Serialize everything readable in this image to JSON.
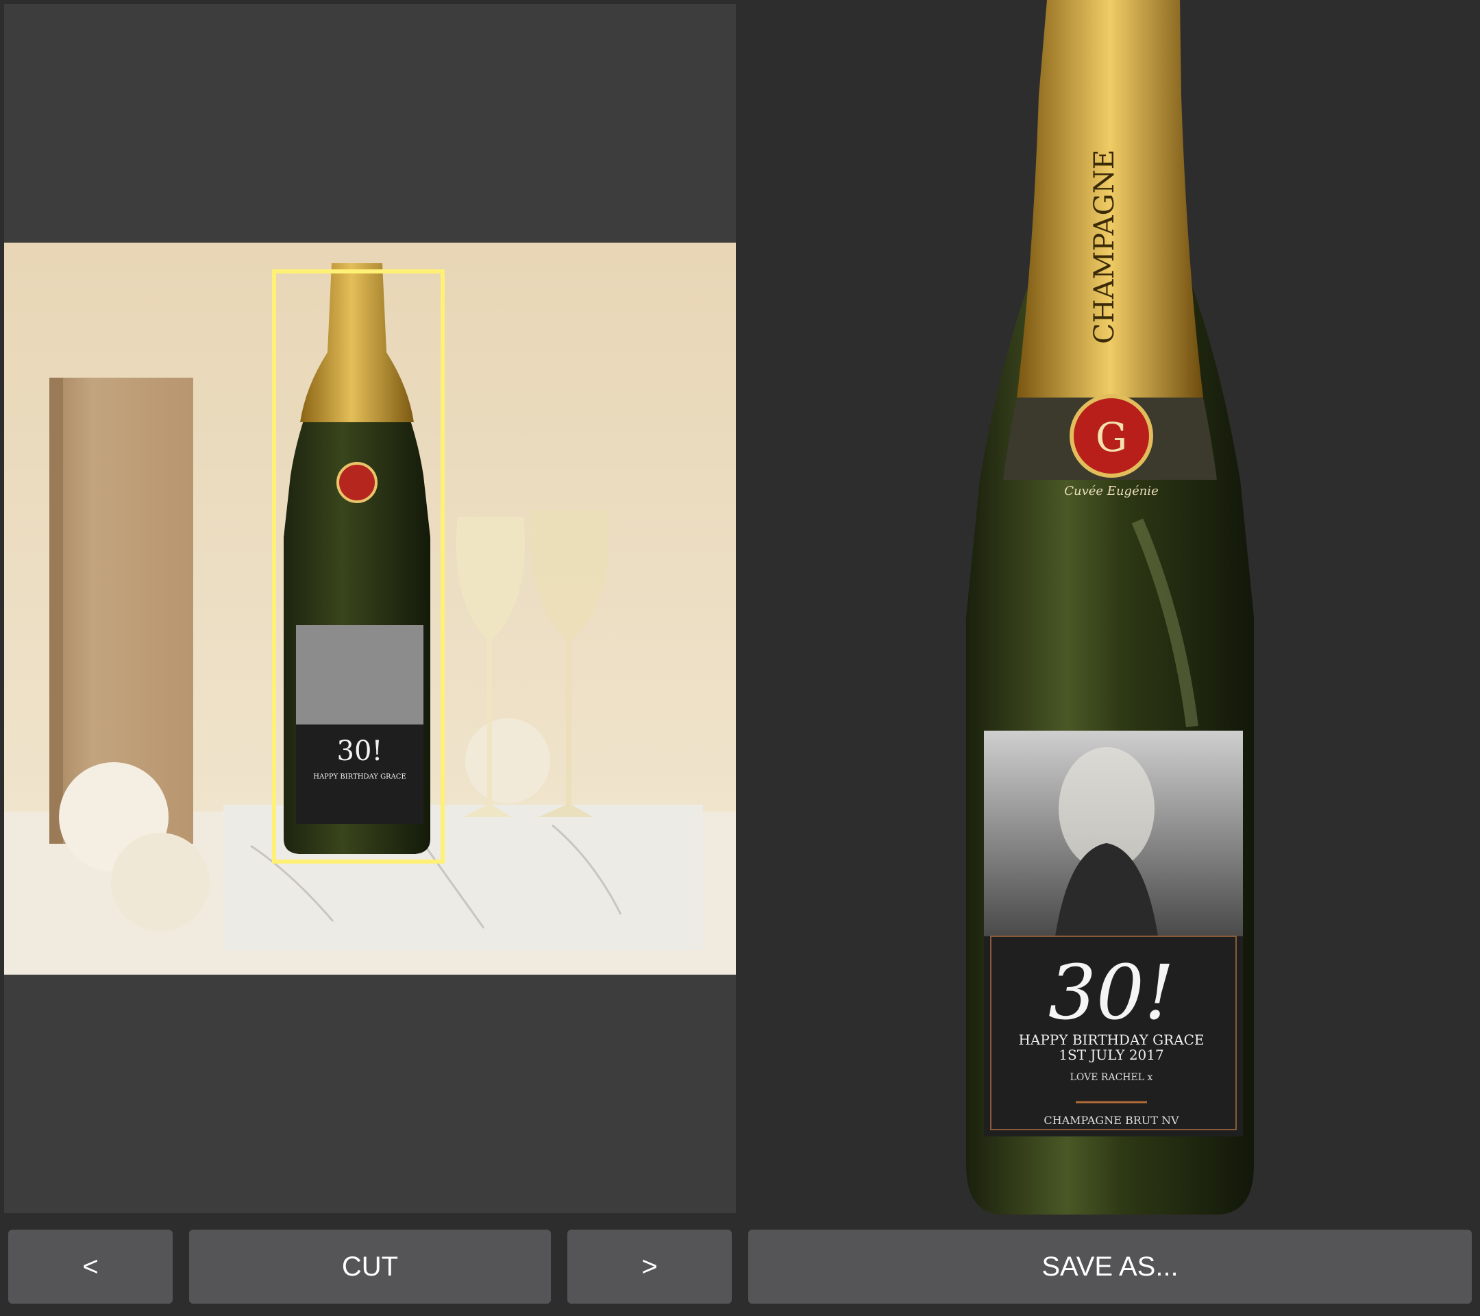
{
  "editor": {
    "source_panel": {
      "label_color": "#3d3d3d"
    },
    "selection_color": "#fff176",
    "bottle_label": {
      "neck_text": "CHAMPAGNE",
      "seal_text": "Cuvée Eugénie",
      "monogram": "G",
      "big_number": "30!",
      "line1": "HAPPY BIRTHDAY GRACE",
      "line2": "1ST JULY 2017",
      "line3": "LOVE RACHEL x",
      "line4": "CHAMPAGNE BRUT NV"
    }
  },
  "toolbar": {
    "prev_label": "<",
    "cut_label": "CUT",
    "next_label": ">",
    "save_label": "SAVE AS..."
  },
  "icons": {
    "prev": "chevron-left-icon",
    "next": "chevron-right-icon"
  }
}
